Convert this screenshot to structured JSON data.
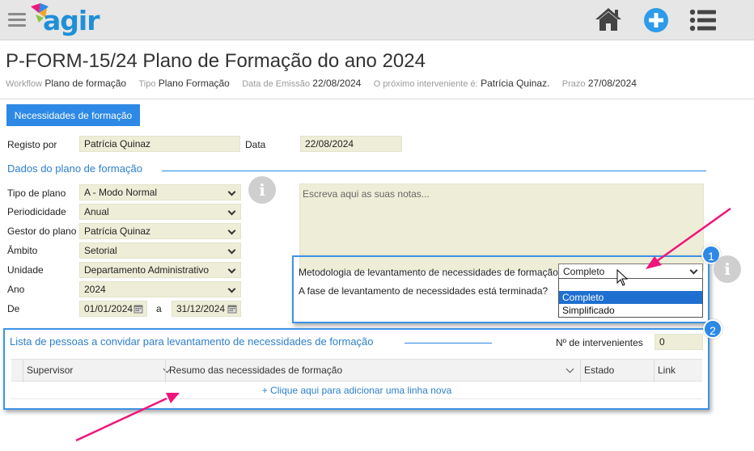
{
  "app": {
    "logo_text": "agir"
  },
  "header": {
    "title": "P-FORM-15/24 Plano de Formação do ano 2024",
    "meta": [
      {
        "key": "Workflow",
        "value": "Plano de formação"
      },
      {
        "key": "Tipo",
        "value": "Plano Formação"
      },
      {
        "key": "Data de Emissão",
        "value": "22/08/2024"
      },
      {
        "key": "O próximo interveniente é:",
        "value": "Patrícia Quinaz."
      },
      {
        "key": "Prazo",
        "value": "27/08/2024"
      }
    ]
  },
  "toolbar": {
    "needs_button": "Necessidades de formação"
  },
  "form": {
    "registo_label": "Registo por",
    "registo_value": "Patrícia Quinaz",
    "data_label": "Data",
    "data_value": "22/08/2024",
    "section1_title": "Dados do plano de formação",
    "tipo_label": "Tipo de plano",
    "tipo_value": "A - Modo Normal",
    "periodicidade_label": "Periodicidade",
    "periodicidade_value": "Anual",
    "gestor_label": "Gestor do plano",
    "gestor_value": "Patrícia Quinaz",
    "ambito_label": "Âmbito",
    "ambito_value": "Setorial",
    "unidade_label": "Unidade",
    "unidade_value": "Departamento Administrativo",
    "ano_label": "Ano",
    "ano_value": "2024",
    "de_label": "De",
    "de_value": "01/01/2024",
    "a_label": "a",
    "ate_value": "31/12/2024",
    "notes_placeholder": "Escreva aqui as suas notas...",
    "metodologia_label": "Metodologia de levantamento de necessidades de formação",
    "metodologia_value": "Completo",
    "metodologia_options": [
      "",
      "Completo",
      "Simplificado"
    ],
    "fase_label": "A fase de levantamento de necessidades está terminada?"
  },
  "list_section": {
    "title": "Lista de pessoas a convidar para levantamento de necessidades de formação",
    "count_label": "Nº de intervenientes",
    "count_value": "0",
    "columns": [
      "Supervisor",
      "Resumo das necessidades de formação",
      "Estado",
      "Link"
    ],
    "add_row": "+ Clique aqui para adicionar uma linha nova"
  },
  "annotations": {
    "badge1": "1",
    "badge2": "2"
  },
  "colors": {
    "accent": "#2d89e5",
    "field_bg": "#eeeed8",
    "arrow": "#f0157a",
    "selected": "#1e6fd0"
  }
}
